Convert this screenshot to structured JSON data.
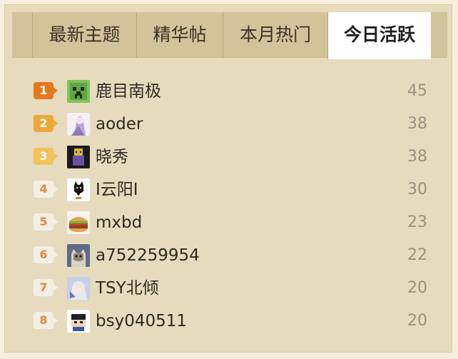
{
  "tabs": [
    {
      "label": "最新主题"
    },
    {
      "label": "精华帖"
    },
    {
      "label": "本月热门"
    },
    {
      "label": "今日活跃"
    }
  ],
  "active_tab": "今日活跃",
  "ranking": [
    {
      "rank": "1",
      "name": "鹿目南极",
      "count": "45",
      "avatar": "creeper-avatar-icon"
    },
    {
      "rank": "2",
      "name": "aoder",
      "count": "38",
      "avatar": "anime-girl-avatar-icon"
    },
    {
      "rank": "3",
      "name": "晓秀",
      "count": "38",
      "avatar": "character-avatar-icon"
    },
    {
      "rank": "4",
      "name": "I云阳I",
      "count": "30",
      "avatar": "black-cat-avatar-icon"
    },
    {
      "rank": "5",
      "name": "mxbd",
      "count": "23",
      "avatar": "burger-avatar-icon"
    },
    {
      "rank": "6",
      "name": "a752259954",
      "count": "22",
      "avatar": "cat-photo-avatar-icon"
    },
    {
      "rank": "7",
      "name": "TSY北倾",
      "count": "20",
      "avatar": "anime-character-avatar-icon"
    },
    {
      "rank": "8",
      "name": "bsy040511",
      "count": "20",
      "avatar": "pixel-character-avatar-icon"
    }
  ],
  "colors": {
    "rank1": "#e37a1e",
    "rank2": "#eea83a",
    "rank3": "#f2c25b",
    "rank_other_text": "#e48a3a",
    "panel_bg": "#e7dbbd",
    "tabbar_bg": "#d3c39a",
    "count_text": "#999180"
  }
}
